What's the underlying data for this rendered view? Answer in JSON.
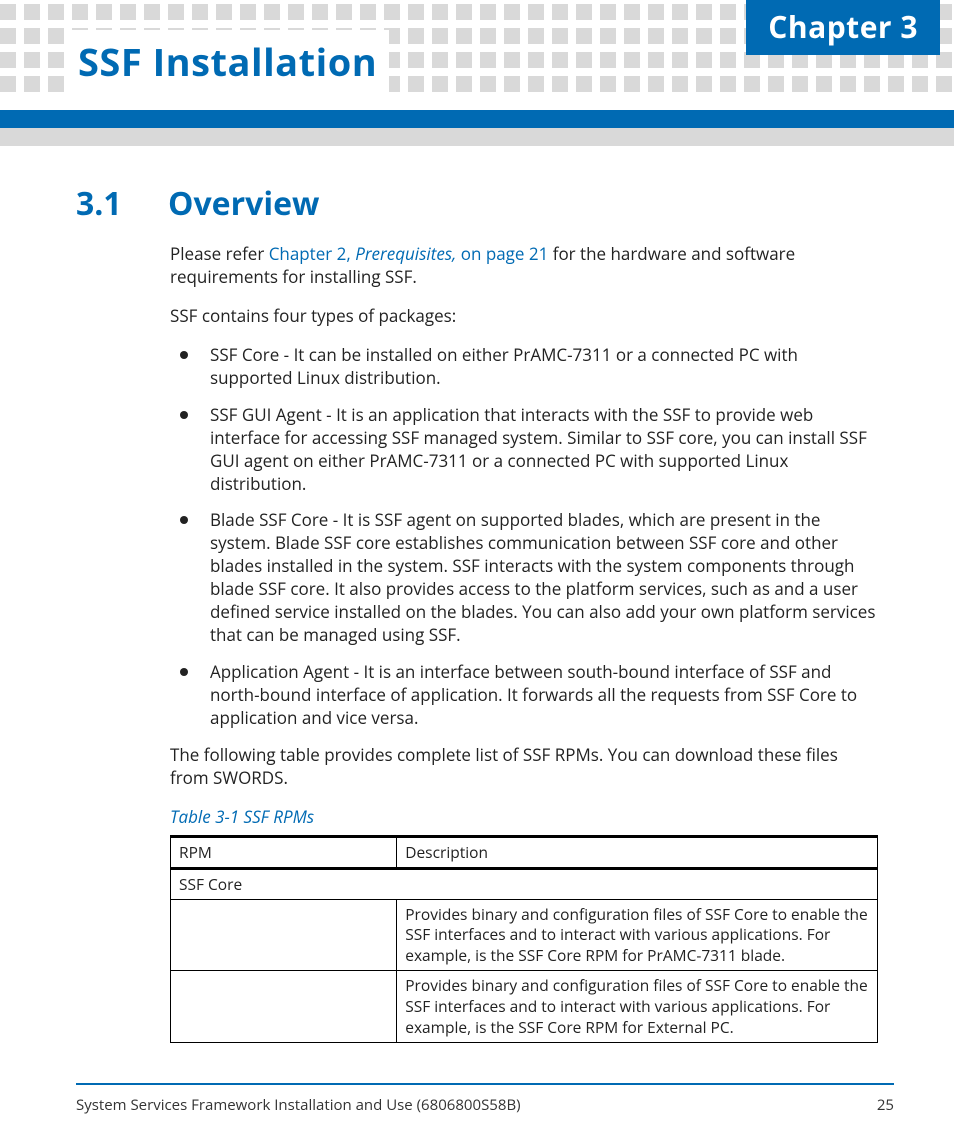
{
  "header": {
    "chapter_label": "Chapter 3",
    "title": "SSF Installation"
  },
  "section": {
    "number": "3.1",
    "title": "Overview",
    "intro_prefix": "Please refer ",
    "intro_xref_chapter": "Chapter 2, ",
    "intro_xref_title": "Prerequisites,",
    "intro_xref_page": " on page 21",
    "intro_suffix": " for the hardware and software requirements for installing SSF.",
    "packages_lead": "SSF contains four types of packages:",
    "packages": [
      "SSF Core - It can be installed on either PrAMC-7311 or a connected PC with supported Linux distribution.",
      "SSF GUI Agent - It is an application that interacts with the SSF to provide web interface for accessing SSF managed system. Similar to SSF core, you can install SSF GUI agent on either PrAMC-7311 or a connected PC with supported Linux distribution.",
      "Blade SSF Core - It is SSF agent on supported blades, which are present in the system. Blade SSF core establishes communication between SSF core and other blades installed in the system. SSF interacts with the system components through blade SSF core. It also provides access to the platform services, such as                                                                                                                          and a user defined service                    installed on the blades. You can also add your own platform services that can be managed using SSF.",
      "Application Agent - It is an interface between south-bound interface of SSF and north-bound interface of application. It forwards all the requests from SSF Core to application and vice versa."
    ],
    "table_lead": "The following table provides complete list of SSF RPMs. You can download these files from SWORDS.",
    "table_caption": "Table 3-1 SSF RPMs",
    "table_headers": {
      "rpm": "RPM",
      "desc": "Description"
    },
    "table_rows": [
      {
        "category": "SSF Core"
      },
      {
        "rpm": "",
        "desc": "Provides binary and configuration files of SSF Core to enable the SSF interfaces and to interact with various applications. For example,                                                                                                                                                           is the SSF Core RPM for PrAMC-7311 blade."
      },
      {
        "rpm": "",
        "desc": "Provides binary and configuration files of SSF Core to enable the SSF interfaces and to interact with various applications. For example,                                                                                                                                                            is the SSF Core RPM for External PC."
      }
    ]
  },
  "footer": {
    "doc_id": "System Services Framework Installation and Use (6806800S58B)",
    "page": "25"
  }
}
